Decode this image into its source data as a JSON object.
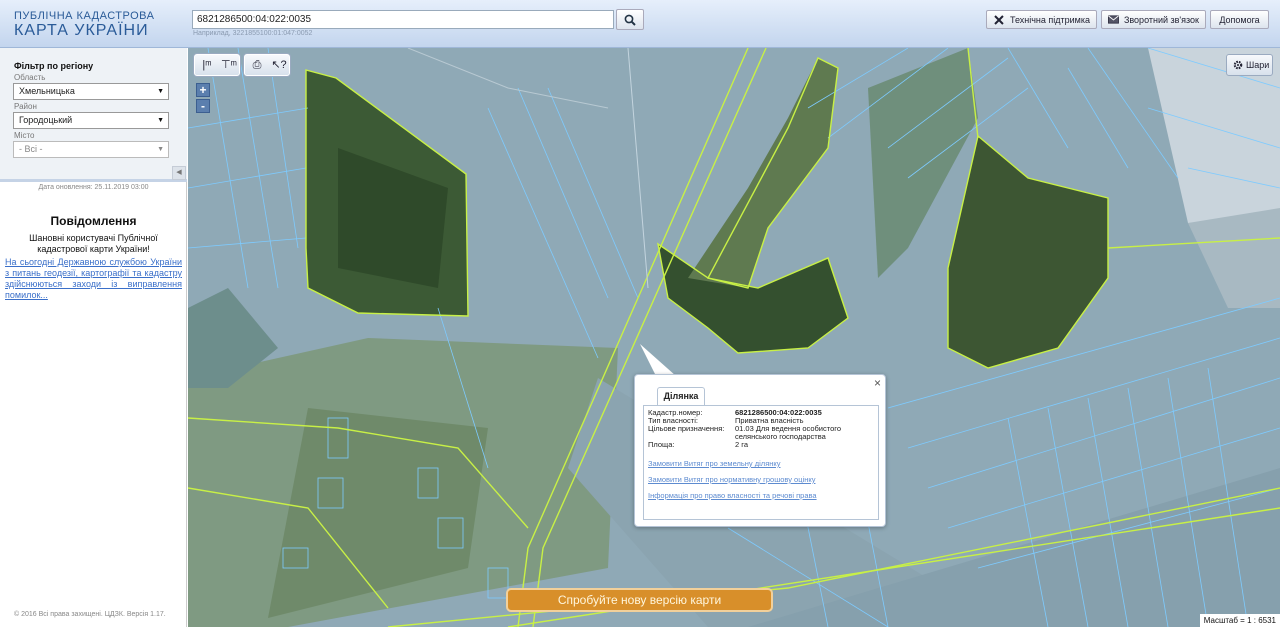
{
  "header": {
    "logo_line1": "ПУБЛІЧНА КАДАСТРОВА",
    "logo_line2": "КАРТА УКРАЇНИ",
    "search_value": "6821286500:04:022:0035",
    "search_hint": "Наприклад, 3221855100:01:047:0052",
    "buttons": {
      "support": "Технічна підтримка",
      "feedback": "Зворотний зв'язок",
      "help": "Допомога"
    }
  },
  "sidebar": {
    "filter_title": "Фільтр по регіону",
    "region_label": "Область",
    "region_value": "Хмельницька",
    "district_label": "Район",
    "district_value": "Городоцький",
    "city_label": "Місто",
    "city_value": "- Всі -",
    "update_date": "Дата оновлення: 25.11.2019 03:00",
    "notification_title": "Повідомлення",
    "notification_text": "Шановні користувачі Публічної кадастрової карти України!",
    "notification_link": "На сьогодні Державною службою України з питань геодезії, картографії та кадастру здійснюються заходи із виправлення помилок...",
    "copyright": "© 2016 Всі права захищені. ЦДЗК. Версія 1.17."
  },
  "map": {
    "zoom_in": "+",
    "zoom_out": "-",
    "layers_label": "Шари",
    "new_map_label": "Спробуйте нову версію карти",
    "scale": "Масштаб = 1 : 6531",
    "colors": {
      "parcel_line": "#7ecbff",
      "boundary_line": "#c8f046",
      "popup_tab": "#ffffff"
    }
  },
  "popup": {
    "tab_label": "Ділянка",
    "close": "×",
    "fields": [
      {
        "key": "Кадастр.номер:",
        "value": "6821286500:04:022:0035"
      },
      {
        "key": "Тип власності:",
        "value": "Приватна власність"
      },
      {
        "key": "Цільове призначення:",
        "value": "01.03 Для ведення особистого селянського господарства"
      },
      {
        "key": "Площа:",
        "value": "2 га"
      }
    ],
    "links": [
      "Замовити Витяг про земельну ділянку",
      "Замовити Витяг про нормативну грошову оцінку",
      "Інформація про право власності та речові права"
    ]
  }
}
